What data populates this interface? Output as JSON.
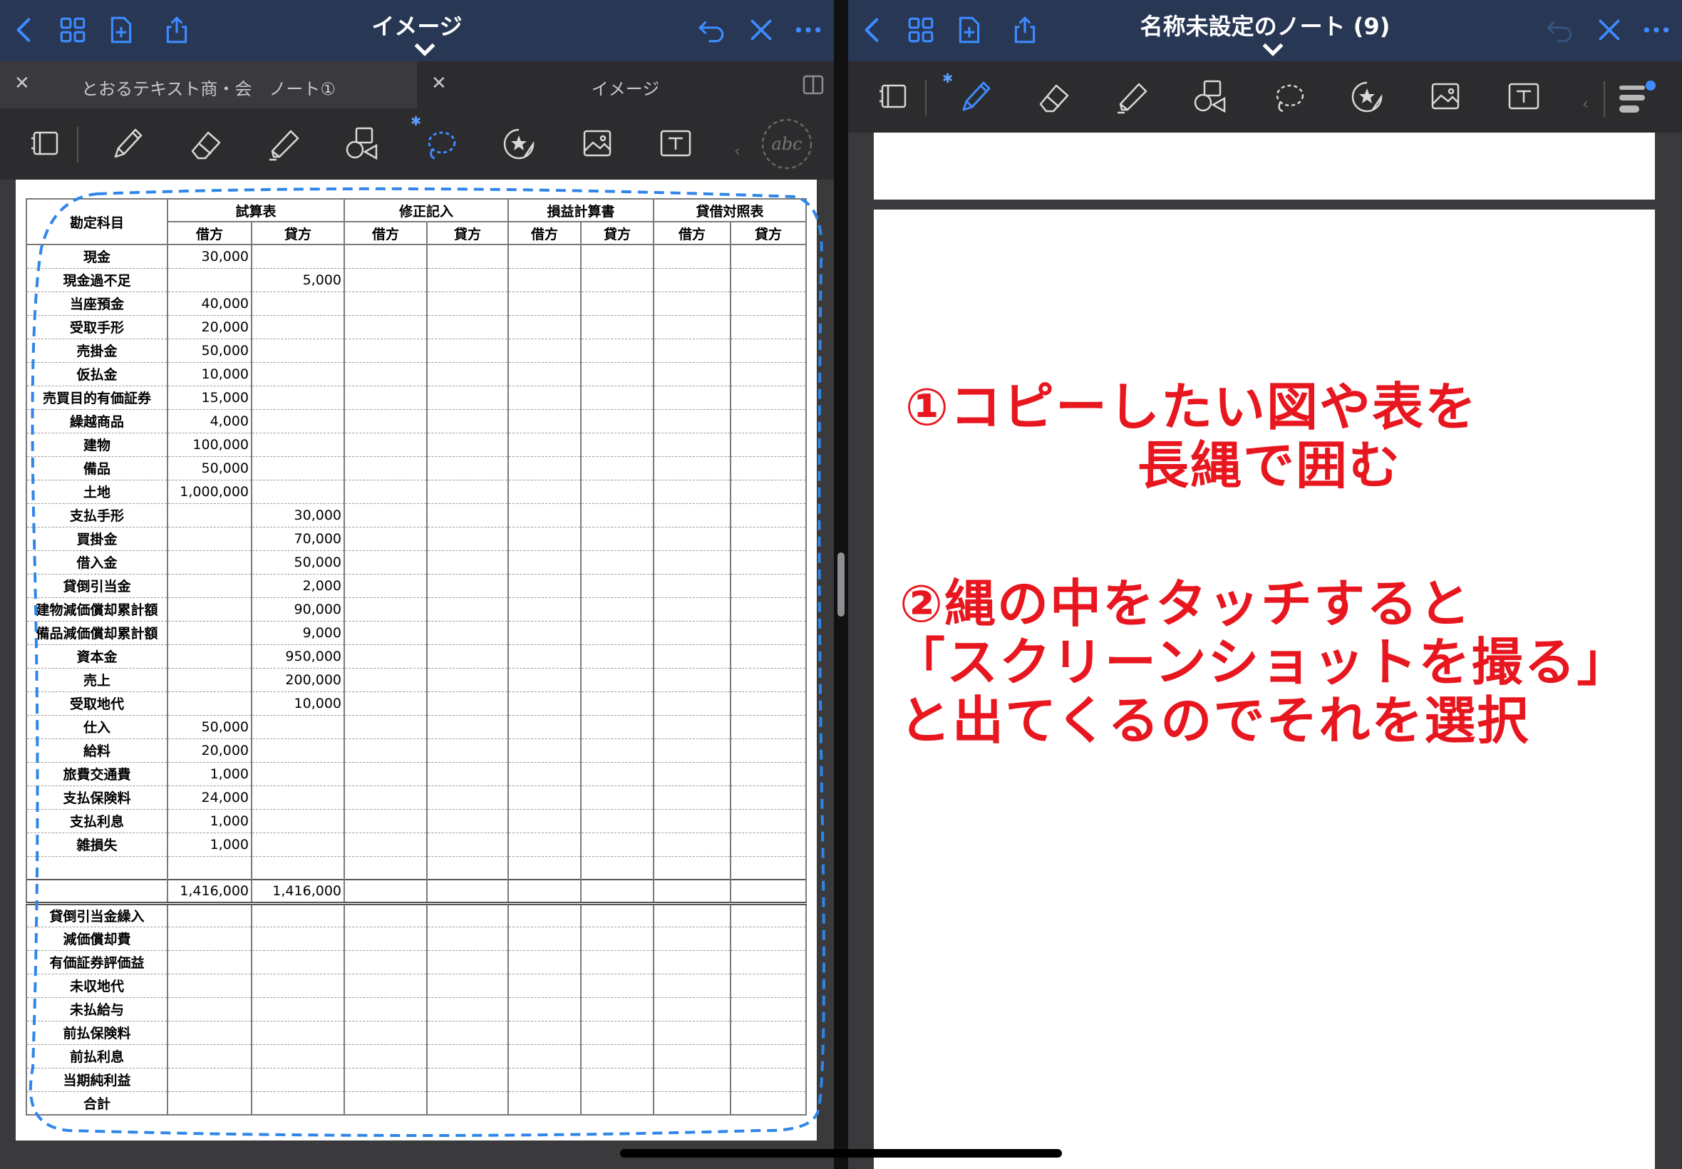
{
  "left": {
    "nav": {
      "title": "イメージ"
    },
    "tabs": [
      {
        "label": "とおるテキスト商・会　ノート①"
      },
      {
        "label": "イメージ"
      }
    ],
    "sheet": {
      "headers": {
        "account": "勘定科目",
        "trial": "試算表",
        "adjust": "修正記入",
        "pl": "損益計算書",
        "bs": "貸借対照表",
        "debit": "借方",
        "credit": "貸方"
      },
      "rows": [
        {
          "account": "現金",
          "debit": "30,000",
          "credit": ""
        },
        {
          "account": "現金過不足",
          "debit": "",
          "credit": "5,000"
        },
        {
          "account": "当座預金",
          "debit": "40,000",
          "credit": ""
        },
        {
          "account": "受取手形",
          "debit": "20,000",
          "credit": ""
        },
        {
          "account": "売掛金",
          "debit": "50,000",
          "credit": ""
        },
        {
          "account": "仮払金",
          "debit": "10,000",
          "credit": ""
        },
        {
          "account": "売買目的有価証券",
          "debit": "15,000",
          "credit": ""
        },
        {
          "account": "繰越商品",
          "debit": "4,000",
          "credit": ""
        },
        {
          "account": "建物",
          "debit": "100,000",
          "credit": ""
        },
        {
          "account": "備品",
          "debit": "50,000",
          "credit": ""
        },
        {
          "account": "土地",
          "debit": "1,000,000",
          "credit": ""
        },
        {
          "account": "支払手形",
          "debit": "",
          "credit": "30,000"
        },
        {
          "account": "買掛金",
          "debit": "",
          "credit": "70,000"
        },
        {
          "account": "借入金",
          "debit": "",
          "credit": "50,000"
        },
        {
          "account": "貸倒引当金",
          "debit": "",
          "credit": "2,000"
        },
        {
          "account": "建物減価償却累計額",
          "debit": "",
          "credit": "90,000"
        },
        {
          "account": "備品減価償却累計額",
          "debit": "",
          "credit": "9,000"
        },
        {
          "account": "資本金",
          "debit": "",
          "credit": "950,000"
        },
        {
          "account": "売上",
          "debit": "",
          "credit": "200,000"
        },
        {
          "account": "受取地代",
          "debit": "",
          "credit": "10,000"
        },
        {
          "account": "仕入",
          "debit": "50,000",
          "credit": ""
        },
        {
          "account": "給料",
          "debit": "20,000",
          "credit": ""
        },
        {
          "account": "旅費交通費",
          "debit": "1,000",
          "credit": ""
        },
        {
          "account": "支払保険料",
          "debit": "24,000",
          "credit": ""
        },
        {
          "account": "支払利息",
          "debit": "1,000",
          "credit": ""
        },
        {
          "account": "雑損失",
          "debit": "1,000",
          "credit": ""
        },
        {
          "account": "",
          "debit": "",
          "credit": ""
        }
      ],
      "total": {
        "debit": "1,416,000",
        "credit": "1,416,000"
      },
      "extra_rows": [
        "貸倒引当金繰入",
        "減価償却費",
        "有価証券評価益",
        "未収地代",
        "未払給与",
        "前払保険料",
        "前払利息",
        "当期純利益",
        "合計"
      ]
    }
  },
  "right": {
    "nav": {
      "title": "名称未設定のノート (9)"
    },
    "note": {
      "line1": "①コピーしたい図や表を",
      "line2": "長縄で囲む",
      "line3": "②縄の中をタッチすると",
      "line4": "「スクリーンショットを撮る」",
      "line5": "と出てくるのでそれを選択"
    }
  },
  "colors": {
    "nav": "#273754",
    "accent": "#3d8bff",
    "annotation": "#e8171f"
  },
  "icons": [
    "back-icon",
    "grid-icon",
    "new-page-icon",
    "share-icon",
    "undo-icon",
    "close-x-icon",
    "more-icon",
    "page-view-icon",
    "pen-icon",
    "eraser-icon",
    "highlighter-icon",
    "shapes-icon",
    "lasso-icon",
    "sticker-icon",
    "image-icon",
    "text-box-icon",
    "handwriting-icon",
    "pen-settings-icon"
  ]
}
